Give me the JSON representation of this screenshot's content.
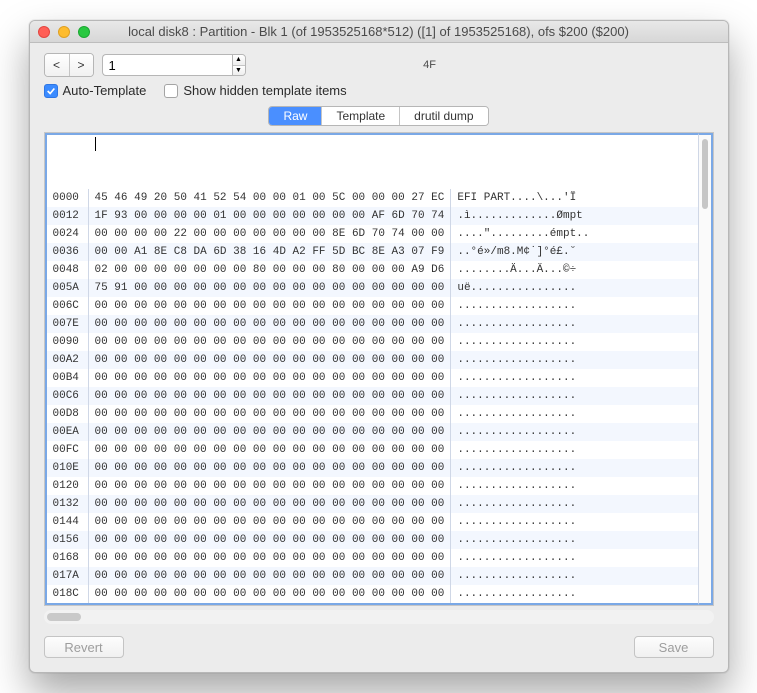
{
  "window": {
    "title": "local disk8 : Partition - Blk 1 (of 1953525168*512) ([1] of 1953525168), ofs $200 ($200)"
  },
  "nav": {
    "prev": "<",
    "next": ">",
    "block_value": "1",
    "center_label": "4F"
  },
  "options": {
    "auto_template_label": "Auto-Template",
    "auto_template_checked": true,
    "show_hidden_label": "Show hidden template items",
    "show_hidden_checked": false
  },
  "tabs": {
    "items": [
      "Raw",
      "Template",
      "drutil dump"
    ],
    "active": 0
  },
  "hex": {
    "rows": [
      {
        "o": "0000",
        "b": "45 46 49 20 50 41 52 54 00 00 01 00 5C 00 00 00 27 EC",
        "a": "EFI PART....\\...'Ï"
      },
      {
        "o": "0012",
        "b": "1F 93 00 00 00 00 01 00 00 00 00 00 00 00 AF 6D 70 74",
        "a": ".ì.............Ømpt"
      },
      {
        "o": "0024",
        "b": "00 00 00 00 22 00 00 00 00 00 00 00 8E 6D 70 74 00 00",
        "a": "....\".........émpt.."
      },
      {
        "o": "0036",
        "b": "00 00 A1 8E C8 DA 6D 38 16 4D A2 FF 5D BC 8E A3 07 F9",
        "a": "..°é»/m8.M¢˙]°é£.˘"
      },
      {
        "o": "0048",
        "b": "02 00 00 00 00 00 00 00 80 00 00 00 80 00 00 00 A9 D6",
        "a": "........Ä...Ä...©÷"
      },
      {
        "o": "005A",
        "b": "75 91 00 00 00 00 00 00 00 00 00 00 00 00 00 00 00 00",
        "a": "uë................"
      },
      {
        "o": "006C",
        "b": "00 00 00 00 00 00 00 00 00 00 00 00 00 00 00 00 00 00",
        "a": ".................."
      },
      {
        "o": "007E",
        "b": "00 00 00 00 00 00 00 00 00 00 00 00 00 00 00 00 00 00",
        "a": ".................."
      },
      {
        "o": "0090",
        "b": "00 00 00 00 00 00 00 00 00 00 00 00 00 00 00 00 00 00",
        "a": ".................."
      },
      {
        "o": "00A2",
        "b": "00 00 00 00 00 00 00 00 00 00 00 00 00 00 00 00 00 00",
        "a": ".................."
      },
      {
        "o": "00B4",
        "b": "00 00 00 00 00 00 00 00 00 00 00 00 00 00 00 00 00 00",
        "a": ".................."
      },
      {
        "o": "00C6",
        "b": "00 00 00 00 00 00 00 00 00 00 00 00 00 00 00 00 00 00",
        "a": ".................."
      },
      {
        "o": "00D8",
        "b": "00 00 00 00 00 00 00 00 00 00 00 00 00 00 00 00 00 00",
        "a": ".................."
      },
      {
        "o": "00EA",
        "b": "00 00 00 00 00 00 00 00 00 00 00 00 00 00 00 00 00 00",
        "a": ".................."
      },
      {
        "o": "00FC",
        "b": "00 00 00 00 00 00 00 00 00 00 00 00 00 00 00 00 00 00",
        "a": ".................."
      },
      {
        "o": "010E",
        "b": "00 00 00 00 00 00 00 00 00 00 00 00 00 00 00 00 00 00",
        "a": ".................."
      },
      {
        "o": "0120",
        "b": "00 00 00 00 00 00 00 00 00 00 00 00 00 00 00 00 00 00",
        "a": ".................."
      },
      {
        "o": "0132",
        "b": "00 00 00 00 00 00 00 00 00 00 00 00 00 00 00 00 00 00",
        "a": ".................."
      },
      {
        "o": "0144",
        "b": "00 00 00 00 00 00 00 00 00 00 00 00 00 00 00 00 00 00",
        "a": ".................."
      },
      {
        "o": "0156",
        "b": "00 00 00 00 00 00 00 00 00 00 00 00 00 00 00 00 00 00",
        "a": ".................."
      },
      {
        "o": "0168",
        "b": "00 00 00 00 00 00 00 00 00 00 00 00 00 00 00 00 00 00",
        "a": ".................."
      },
      {
        "o": "017A",
        "b": "00 00 00 00 00 00 00 00 00 00 00 00 00 00 00 00 00 00",
        "a": ".................."
      },
      {
        "o": "018C",
        "b": "00 00 00 00 00 00 00 00 00 00 00 00 00 00 00 00 00 00",
        "a": ".................."
      }
    ]
  },
  "footer": {
    "revert": "Revert",
    "save": "Save"
  }
}
